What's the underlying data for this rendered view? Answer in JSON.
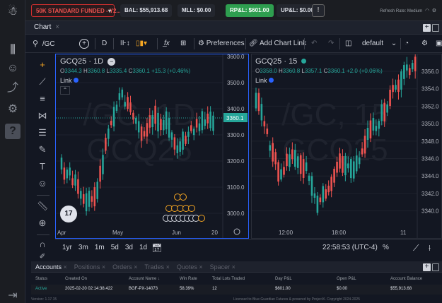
{
  "topbar": {
    "account": "50K STANDARD FUNDED - Y2...",
    "balance": "BAL: $55,913.68",
    "mll": "MLL: $0.00",
    "rpl": "RP&L: $601.00",
    "upl": "UP&L: $0.00",
    "info": "!",
    "refresh": "Refresh Rate: Medium"
  },
  "tabs": {
    "chart": "Chart"
  },
  "toolbar": {
    "symbol": "/GC",
    "add": "+",
    "interval": "D",
    "preferences": "Preferences",
    "add_chart_link": "Add Chart Link",
    "layout": "default"
  },
  "left_chart": {
    "title": "GCQ25 · 1D",
    "o": "3344.3",
    "h": "3360.8",
    "l": "3335.4",
    "c": "3360.1",
    "chg": "+15.3 (+0.46%)",
    "link": "Link",
    "last_price": "3360.1",
    "watermark1": "/GC, 1D",
    "watermark2": "GCQ25",
    "y_ticks": [
      "3600.0",
      "3500.0",
      "3400.0",
      "3300.0",
      "3200.0",
      "3100.0",
      "3000.0"
    ],
    "x_ticks": [
      "Apr",
      "May",
      "Jun",
      "20"
    ]
  },
  "right_chart": {
    "title": "GCQ25 · 15",
    "o": "3358.0",
    "h": "3360.8",
    "l": "3357.1",
    "c": "3360.1",
    "chg": "+2.0 (+0.06%)",
    "link": "Link",
    "watermark1": "/GC, 15",
    "watermark2": "GCQ25",
    "y_ticks": [
      "3356.0",
      "3354.0",
      "3352.0",
      "3350.0",
      "3348.0",
      "3346.0",
      "3344.0",
      "3342.0",
      "3340.0"
    ],
    "x_ticks": [
      "12:00",
      "18:00",
      "11"
    ]
  },
  "timeframes": [
    "1yr",
    "3m",
    "1m",
    "5d",
    "3d",
    "1d"
  ],
  "clock": "22:58:53 (UTC-4)",
  "percent": "%",
  "bottom_tabs": [
    "Accounts",
    "Positions",
    "Orders",
    "Trades",
    "Quotes",
    "Spacer"
  ],
  "accounts_table": {
    "headers": [
      "Status",
      "Created On",
      "Account Name",
      "Win Rate",
      "Total Lots Traded",
      "Day P&L",
      "Open P&L",
      "Account Balance"
    ],
    "row": [
      "Active",
      "2025-02-20 02:14:38.422",
      "BGF-PX-14073",
      "58.39%",
      "12",
      "$601.00",
      "$0.00",
      "$55,913.68"
    ]
  },
  "footer": {
    "version": "Version: 1.17.15",
    "license": "Licensed to Blue Guardian Futures & powered by ProjectX. Copyright 2024-2025"
  },
  "colors": {
    "up": "#26a69a",
    "down": "#ef5350",
    "accent": "#2962ff",
    "rpl_bg": "#2e9e4f",
    "price_label": "#26a69a"
  }
}
